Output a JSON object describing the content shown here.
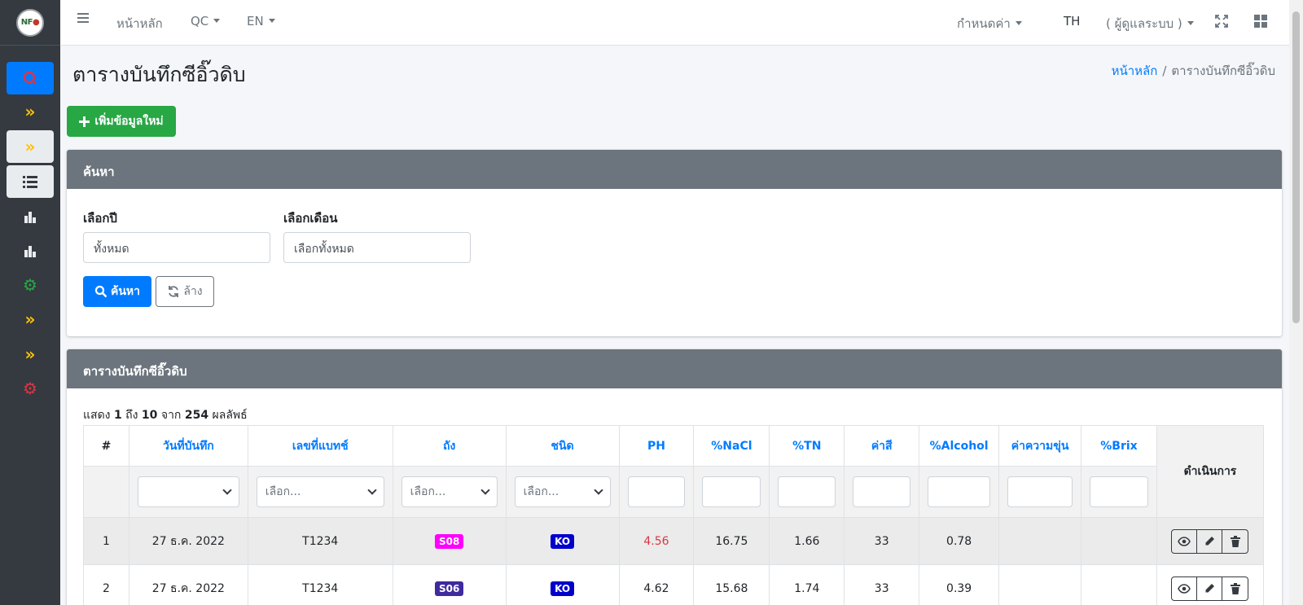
{
  "navbar": {
    "home": "หน้าหลัก",
    "qc": "QC",
    "lang": "EN",
    "settings": "กำหนดค่า",
    "th": "TH",
    "user": "( ผู้ดูแลระบบ )"
  },
  "brand": {
    "logo_text": "NF"
  },
  "page": {
    "title": "ตารางบันทึกซีอิ๊วดิบ",
    "breadcrumb_home": "หน้าหลัก",
    "breadcrumb_sep": "/",
    "breadcrumb_current": "ตารางบันทึกซีอิ๊วดิบ",
    "add_label": "เพิ่มข้อมูลใหม่"
  },
  "search": {
    "header": "ค้นหา",
    "year_label": "เลือกปี",
    "year_value": "ทั้งหมด",
    "month_label": "เลือกเดือน",
    "month_value": "เลือกทั้งหมด",
    "search_label": "ค้นหา",
    "clear_label": "ล้าง"
  },
  "table": {
    "header": "ตารางบันทึกซีอิ๊วดิบ",
    "info_show": "แสดง",
    "info_from": "1",
    "info_to_word": "ถึง",
    "info_to": "10",
    "info_of_word": "จาก",
    "info_total": "254",
    "info_results": "ผลลัพธ์",
    "columns": [
      "#",
      "วันที่บันทึก",
      "เลขที่แบทช์",
      "ถัง",
      "ชนิด",
      "PH",
      "%NaCl",
      "%TN",
      "ค่าสี",
      "%Alcohol",
      "ค่าความขุ่น",
      "%Brix",
      "ดำเนินการ"
    ],
    "select_placeholder": "เลือก...",
    "rows": [
      {
        "no": "1",
        "date": "27 ธ.ค. 2022",
        "batch": "T1234",
        "tank": "S08",
        "tank_color": "#ff00ff",
        "type": "KO",
        "type_color": "#0000cc",
        "ph": "4.56",
        "nacl": "16.75",
        "tn": "1.66",
        "color": "33",
        "alcohol": "0.78",
        "turbidity": "",
        "brix": ""
      },
      {
        "no": "2",
        "date": "27 ธ.ค. 2022",
        "batch": "T1234",
        "tank": "S06",
        "tank_color": "#3f2a9e",
        "type": "KO",
        "type_color": "#0000cc",
        "ph": "4.62",
        "nacl": "15.68",
        "tn": "1.74",
        "color": "33",
        "alcohol": "0.39",
        "turbidity": "",
        "brix": ""
      }
    ]
  }
}
